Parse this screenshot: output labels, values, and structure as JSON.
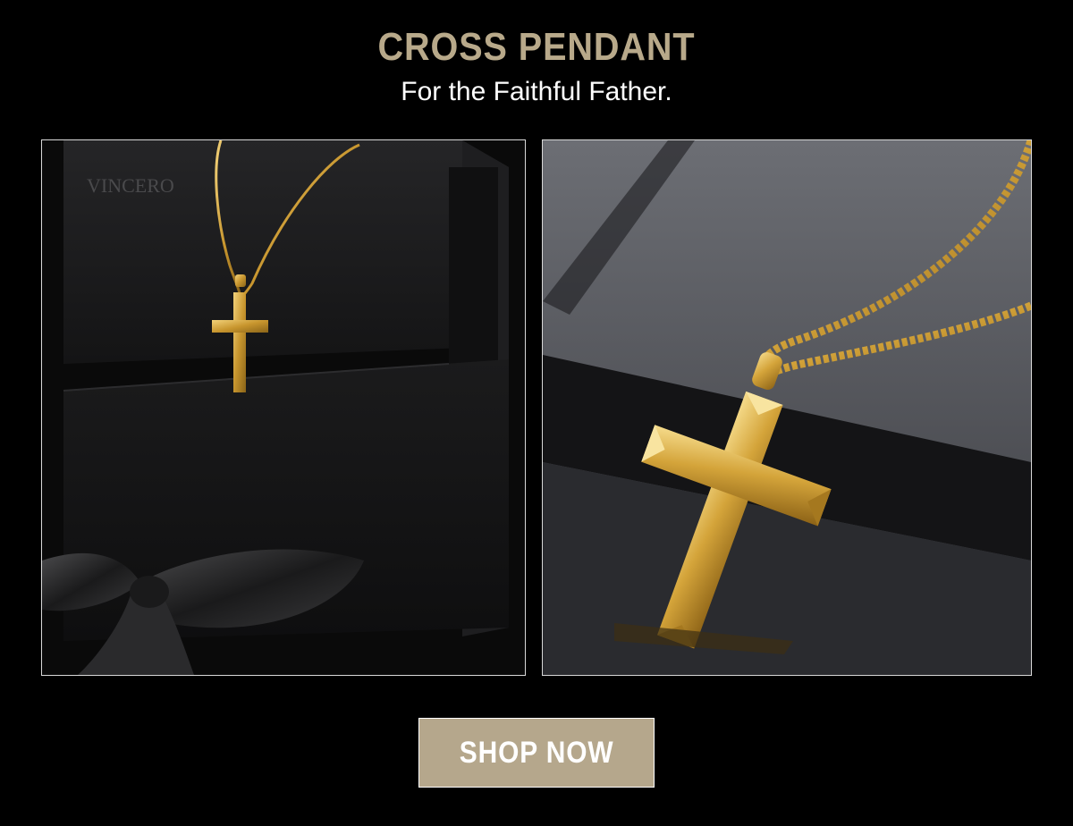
{
  "header": {
    "title": "CROSS PENDANT",
    "subtitle": "For the Faithful Father."
  },
  "left_image": {
    "brand_mark": "VINCERO"
  },
  "cta": {
    "label": "SHOP NOW"
  },
  "colors": {
    "background": "#000000",
    "accent_gold": "#b8a98a",
    "button_bg": "#b5a78c",
    "pendant_gold": "#d4a43a"
  }
}
